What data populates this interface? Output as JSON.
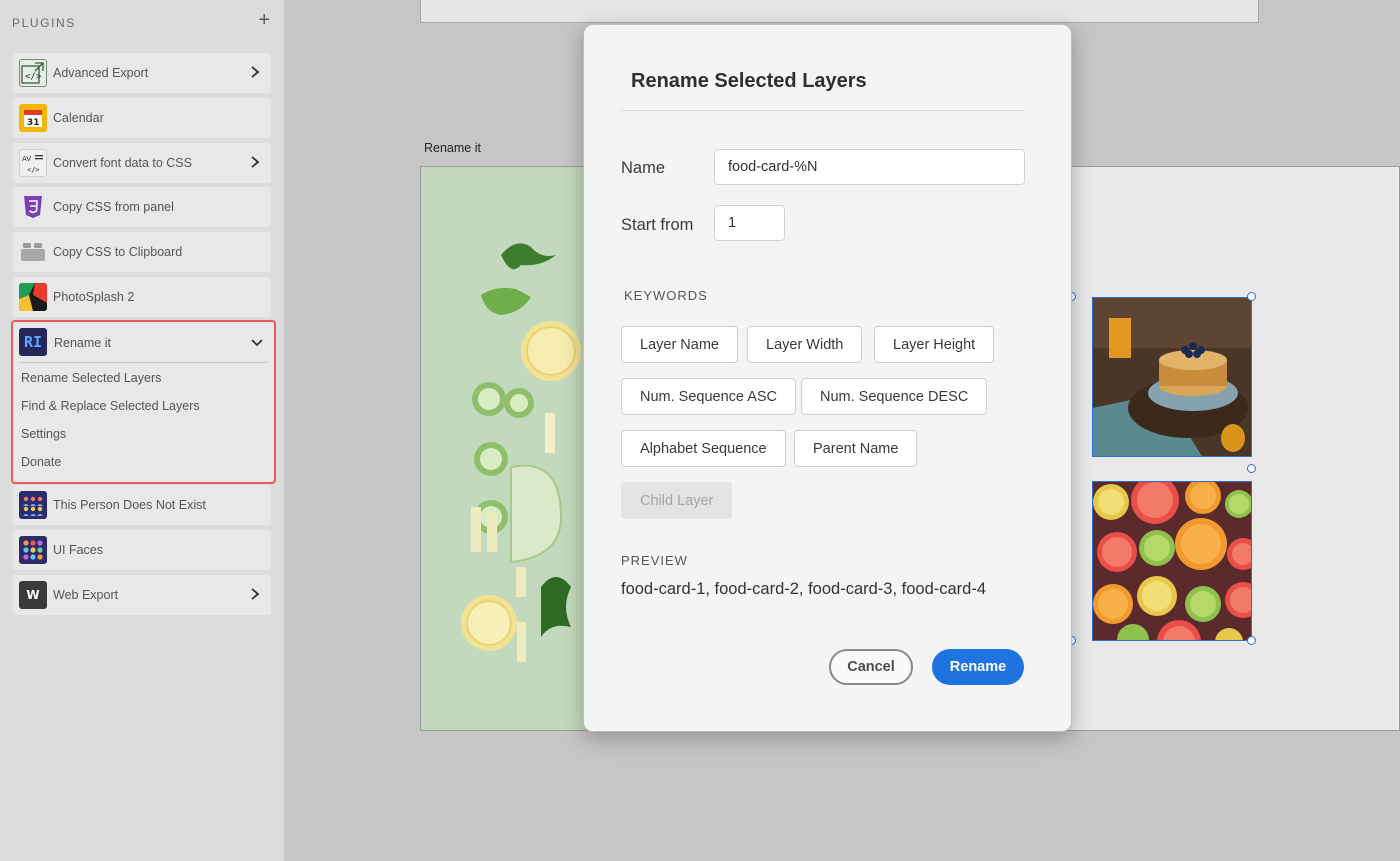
{
  "sidebar": {
    "title": "PLUGINS",
    "add_icon": "plus-icon",
    "items": [
      {
        "label": "Advanced Export",
        "icon": "code-export-icon",
        "has_chevron": true
      },
      {
        "label": "Calendar",
        "icon": "calendar-icon",
        "icon_text": "31",
        "has_chevron": false
      },
      {
        "label": "Convert font data to CSS",
        "icon": "font-css-icon",
        "icon_text": "AV",
        "has_chevron": true
      },
      {
        "label": "Copy CSS from panel",
        "icon": "css3-icon",
        "has_chevron": false
      },
      {
        "label": "Copy CSS to Clipboard",
        "icon": "clipboard-icon",
        "has_chevron": false
      },
      {
        "label": "PhotoSplash 2",
        "icon": "photosplash-icon",
        "has_chevron": false
      }
    ],
    "rename_it": {
      "label": "Rename it",
      "icon_text": "RI",
      "expanded": true,
      "subitems": [
        "Rename Selected Layers",
        "Find & Replace Selected Layers",
        "Settings",
        "Donate"
      ]
    },
    "items_after": [
      {
        "label": "This Person Does Not Exist",
        "icon": "people-icon",
        "has_chevron": false
      },
      {
        "label": "UI Faces",
        "icon": "faces-grid-icon",
        "has_chevron": false
      },
      {
        "label": "Web Export",
        "icon": "web-export-icon",
        "icon_text": "W",
        "has_chevron": true
      }
    ]
  },
  "canvas": {
    "artboard_label": "Rename it",
    "selection_color": "#2e6fd6"
  },
  "dialog": {
    "title": "Rename Selected Layers",
    "name_label": "Name",
    "name_value": "food-card-%N",
    "start_label": "Start from",
    "start_value": "1",
    "keywords_label": "KEYWORDS",
    "keywords": [
      {
        "label": "Layer Name",
        "enabled": true
      },
      {
        "label": "Layer Width",
        "enabled": true
      },
      {
        "label": "Layer Height",
        "enabled": true
      },
      {
        "label": "Num. Sequence ASC",
        "enabled": true
      },
      {
        "label": "Num. Sequence DESC",
        "enabled": true
      },
      {
        "label": "Alphabet Sequence",
        "enabled": true
      },
      {
        "label": "Parent Name",
        "enabled": true
      },
      {
        "label": "Child Layer",
        "enabled": false
      }
    ],
    "preview_label": "PREVIEW",
    "preview_text": "food-card-1, food-card-2, food-card-3, food-card-4",
    "cancel_label": "Cancel",
    "rename_label": "Rename",
    "accent_color": "#1f73e0"
  }
}
